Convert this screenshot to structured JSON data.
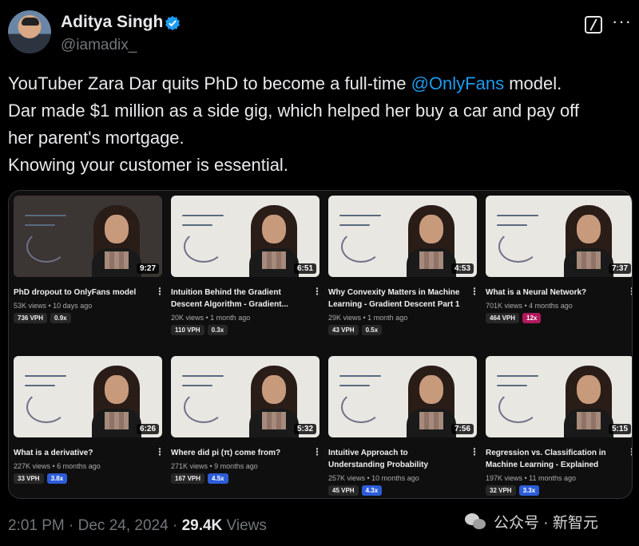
{
  "author": {
    "name": "Aditya Singh",
    "handle": "@iamadix_",
    "avatar_icon": "avatar",
    "verified_icon": "verified-badge-icon"
  },
  "tweet": {
    "line1_prefix": "YouTuber Zara Dar quits PhD to become a full-time ",
    "mention": "@OnlyFans",
    "line1_suffix": " model.",
    "line2": "Dar made $1 million as a side gig, which helped her buy a car and pay off",
    "line3": "her parent's mortgage.",
    "line4": "Knowing your customer is essential."
  },
  "videos": [
    {
      "title": "PhD dropout to OnlyFans model",
      "duration": "9:27",
      "meta": "53K views • 10 days ago",
      "vph": "736 VPH",
      "ratio": "0.9x",
      "ratio_color": "gray"
    },
    {
      "title": "Intuition Behind the Gradient Descent Algorithm - Gradient...",
      "duration": "6:51",
      "meta": "20K views • 1 month ago",
      "vph": "110 VPH",
      "ratio": "0.3x",
      "ratio_color": "gray"
    },
    {
      "title": "Why Convexity Matters in Machine Learning - Gradient Descent Part 1",
      "duration": "4:53",
      "meta": "29K views • 1 month ago",
      "vph": "43 VPH",
      "ratio": "0.5x",
      "ratio_color": "gray"
    },
    {
      "title": "What is a Neural Network?",
      "duration": "7:37",
      "meta": "701K views • 4 months ago",
      "vph": "464 VPH",
      "ratio": "12x",
      "ratio_color": "red"
    },
    {
      "title": "What is a derivative?",
      "duration": "6:26",
      "meta": "227K views • 6 months ago",
      "vph": "33 VPH",
      "ratio": "3.8x",
      "ratio_color": "blue"
    },
    {
      "title": "Where did pi (π) come from?",
      "duration": "5:32",
      "meta": "271K views • 9 months ago",
      "vph": "167 VPH",
      "ratio": "4.5x",
      "ratio_color": "blue"
    },
    {
      "title": "Intuitive Approach to Understanding Probability",
      "duration": "7:56",
      "meta": "257K views • 10 months ago",
      "vph": "45 VPH",
      "ratio": "4.3x",
      "ratio_color": "blue"
    },
    {
      "title": "Regression vs. Classification in Machine Learning - Explained",
      "duration": "5:15",
      "meta": "197K views • 11 months ago",
      "vph": "32 VPH",
      "ratio": "3.3x",
      "ratio_color": "blue"
    }
  ],
  "footer": {
    "time": "2:01 PM · Dec 24, 2024 · ",
    "views_count": "29.4K",
    "views_label": " Views"
  },
  "watermark": {
    "text": "公众号 · 新智元"
  },
  "icons": {
    "grok": "grok-icon",
    "more": "more-icon",
    "menu": "kebab-menu-icon"
  },
  "colors": {
    "mention": "#1d9bf0",
    "verified": "#1d9bf0",
    "ratio_blue": "#2c5cd8",
    "ratio_red": "#b0195d"
  }
}
